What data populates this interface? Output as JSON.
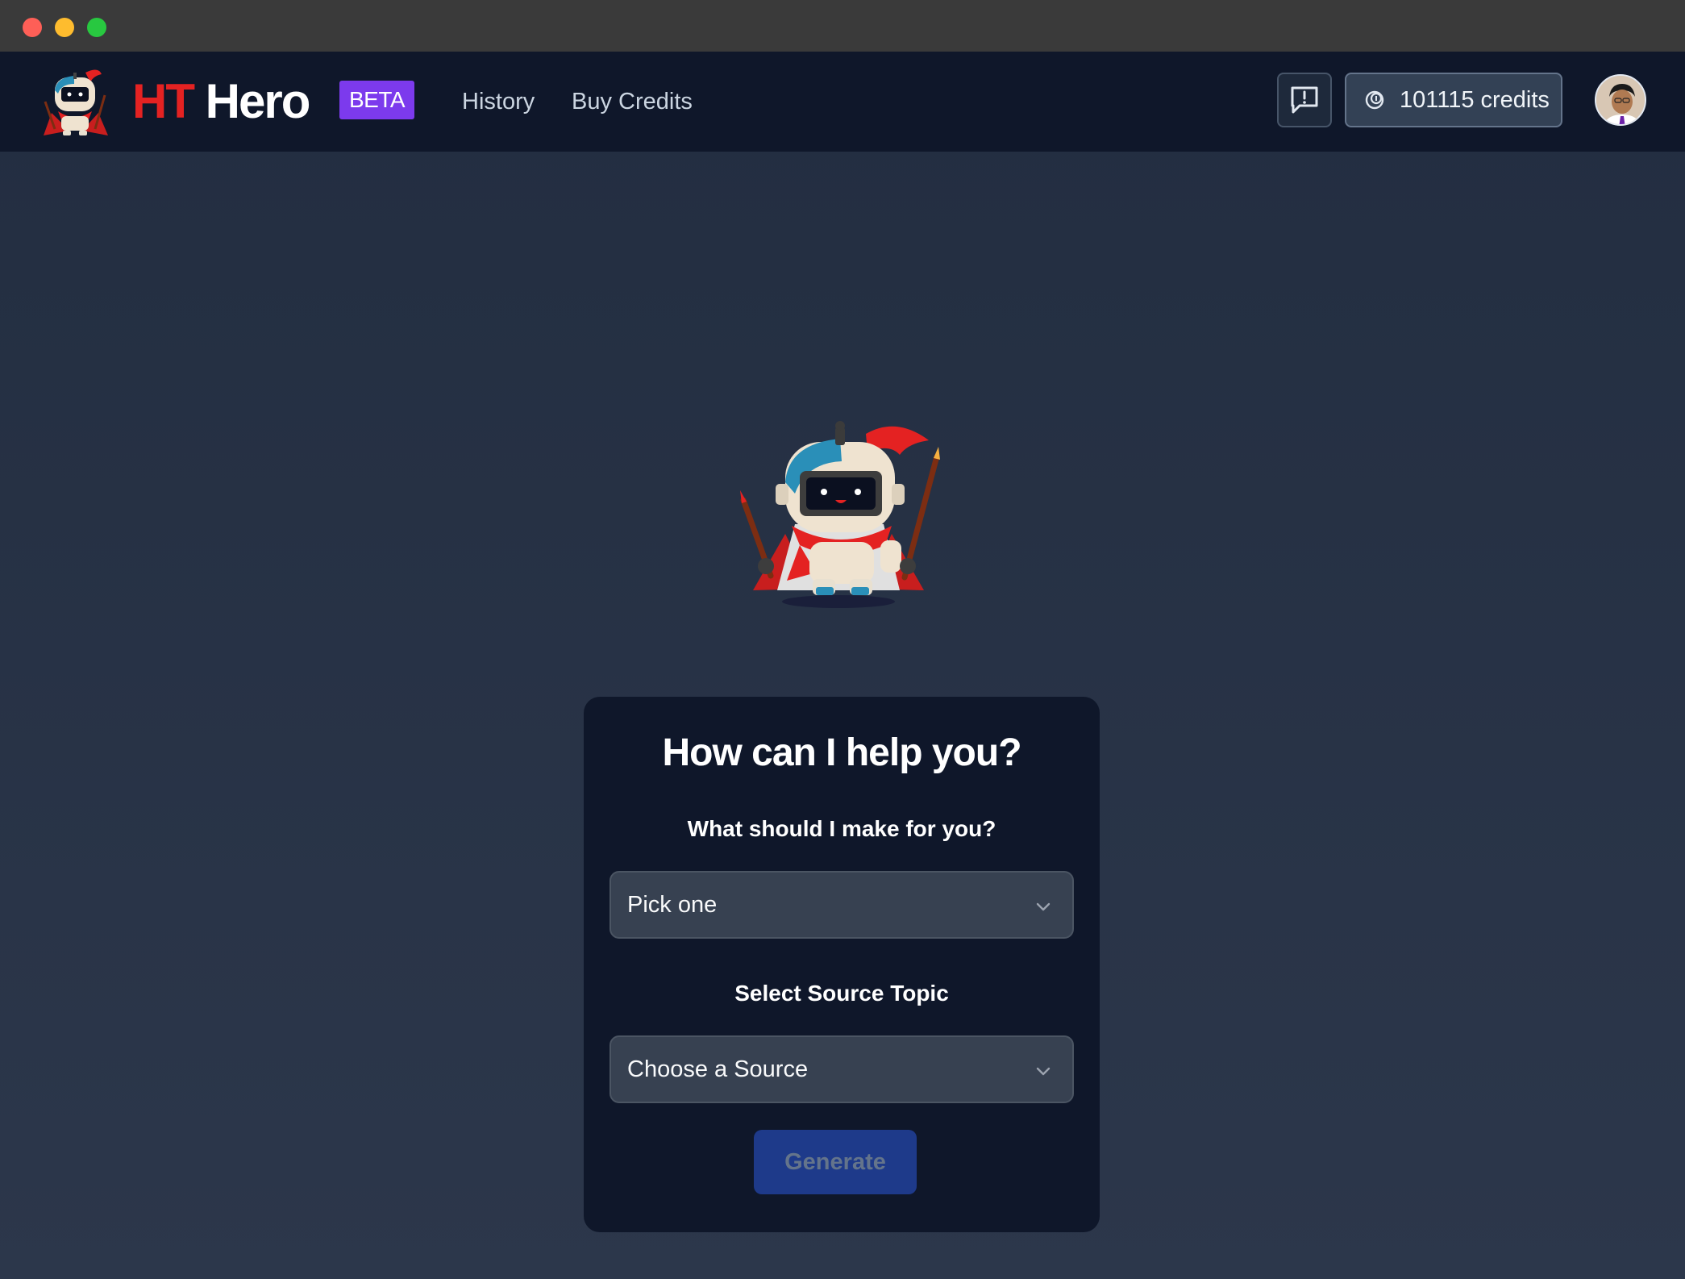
{
  "navbar": {
    "brand_part1": "HT",
    "brand_part2": "Hero",
    "badge": "BETA",
    "links": [
      {
        "label": "History"
      },
      {
        "label": "Buy Credits"
      }
    ],
    "credits_label": "101115 credits"
  },
  "card": {
    "title": "How can I help you?",
    "make_label": "What should I make for you?",
    "make_select_value": "Pick one",
    "source_label": "Select Source Topic",
    "source_select_value": "Choose a Source",
    "generate_label": "Generate"
  },
  "icons": {
    "feedback": "feedback-icon",
    "credits": "coin-icon",
    "chevron": "chevron-down-icon"
  },
  "colors": {
    "navbar_bg": "#0f172a",
    "brand_red": "#e42222",
    "beta_purple": "#7c3aed",
    "card_bg": "#0f172a",
    "select_bg": "#374151",
    "generate_bg": "#1e3a8a"
  }
}
